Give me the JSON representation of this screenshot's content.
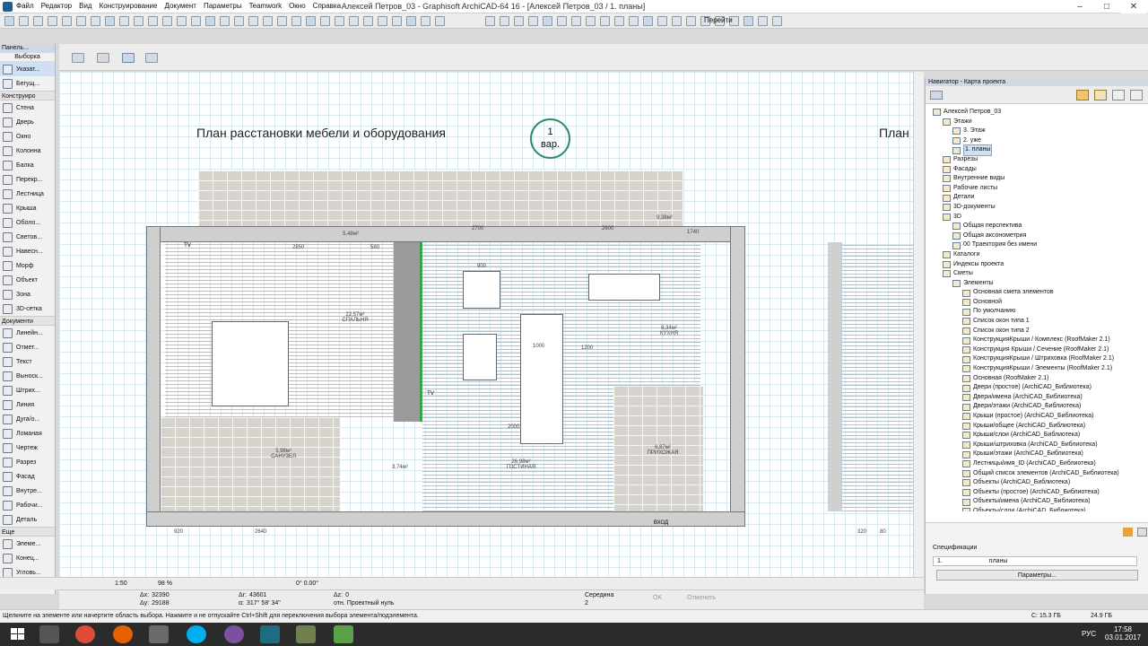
{
  "window": {
    "title": "Алексей Петров_03 - Graphisoft ArchiCAD-64 16 - [Алексей Петров_03 / 1. планы]",
    "menu": [
      "Файл",
      "Редактор",
      "Вид",
      "Конструирование",
      "Документ",
      "Параметры",
      "Teamwork",
      "Окно",
      "Справка"
    ],
    "controls": {
      "minimize": "–",
      "maximize": "□",
      "close": "✕"
    }
  },
  "toolbar": {
    "goto_label": "Перейти"
  },
  "left_panel": {
    "header": "Панель...",
    "selection_title": "Выборка",
    "sections": {
      "construct": "Конструиро",
      "document": "Документи",
      "more": "Еще"
    },
    "top_items": [
      "Указат...",
      "Бегущ..."
    ],
    "construct_items": [
      "Стена",
      "Дверь",
      "Окно",
      "Колонна",
      "Балка",
      "Перекр...",
      "Лестница",
      "Крыша",
      "Оболо...",
      "Светов...",
      "Навесн...",
      "Морф",
      "Объект",
      "Зона",
      "3D-сетка"
    ],
    "document_items": [
      "Линейн...",
      "Отмет...",
      "Текст",
      "Выноск...",
      "Штрих...",
      "Линия",
      "Дуга/о...",
      "Ломаная",
      "Чертеж",
      "Разрез",
      "Фасад",
      "Внутре...",
      "Рабочи...",
      "Деталь"
    ],
    "more_items": [
      "Элеме...",
      "Конец...",
      "Угловь..."
    ]
  },
  "drawing": {
    "title": "План расстановки мебели и оборудования",
    "badge_line1": "1",
    "badge_line2": "вар.",
    "title_clip": "План",
    "rooms": [
      {
        "name": "СПАЛЬНЯ",
        "area": "22,57м²"
      },
      {
        "name": "КУХНЯ",
        "area": "8,34м²"
      },
      {
        "name": "САНУЗЕЛ",
        "area": "5,98м²"
      },
      {
        "name": "ГОСТИНАЯ",
        "area": "26,98м²"
      },
      {
        "name": "ПРИХОЖАЯ",
        "area": "6,87м²"
      },
      {
        "name": "",
        "area": "3,74м²"
      },
      {
        "name": "",
        "area": "5,48м²"
      },
      {
        "name": "",
        "area": "9,38м²"
      }
    ],
    "tv_label": "TV",
    "entry_label": "ВХОД",
    "dims": [
      "2850",
      "580",
      "2700",
      "2600",
      "1200",
      "920",
      "2640",
      "320",
      "80",
      "900",
      "1000",
      "2000",
      "1740"
    ]
  },
  "navigator": {
    "header": "Навигатор - Карта проекта",
    "tree": [
      {
        "level": 0,
        "label": "Алексей Петров_03"
      },
      {
        "level": 1,
        "label": "Этажи"
      },
      {
        "level": 2,
        "label": "3. Этаж"
      },
      {
        "level": 2,
        "label": "2. уже"
      },
      {
        "level": 2,
        "label": "1. планы",
        "selected": true
      },
      {
        "level": 1,
        "label": "Разрезы"
      },
      {
        "level": 1,
        "label": "Фасады"
      },
      {
        "level": 1,
        "label": "Внутренние виды"
      },
      {
        "level": 1,
        "label": "Рабочие листы"
      },
      {
        "level": 1,
        "label": "Детали"
      },
      {
        "level": 1,
        "label": "3D-документы"
      },
      {
        "level": 1,
        "label": "3D"
      },
      {
        "level": 2,
        "label": "Общая перспектива"
      },
      {
        "level": 2,
        "label": "Общая аксонометрия"
      },
      {
        "level": 2,
        "label": "00 Траектория без имени"
      },
      {
        "level": 1,
        "label": "Каталоги"
      },
      {
        "level": 1,
        "label": "Индексы проекта"
      },
      {
        "level": 1,
        "label": "Сметы"
      },
      {
        "level": 2,
        "label": "Элементы"
      },
      {
        "level": 3,
        "label": "Основная смета элементов"
      },
      {
        "level": 3,
        "label": "Основной"
      },
      {
        "level": 3,
        "label": "По умолчанию"
      },
      {
        "level": 3,
        "label": "Список окон типа 1"
      },
      {
        "level": 3,
        "label": "Список окон типа 2"
      },
      {
        "level": 3,
        "label": "КонструкцияКрыши / Комплекс (RoofMaker 2.1)"
      },
      {
        "level": 3,
        "label": "Конструкция Крыши / Сечение (RoofMaker 2.1)"
      },
      {
        "level": 3,
        "label": "КонструкцияКрыши / Штриховка (RoofMaker 2.1)"
      },
      {
        "level": 3,
        "label": "КонструкцияКрыши / Элементы (RoofMaker 2.1)"
      },
      {
        "level": 3,
        "label": "Основная (RoofMaker 2.1)"
      },
      {
        "level": 3,
        "label": "Двери (простое) (ArchiCAD_Библиотека)"
      },
      {
        "level": 3,
        "label": "Двери/имена (ArchiCAD_Библиотека)"
      },
      {
        "level": 3,
        "label": "Двери/этажи (ArchiCAD_Библиотека)"
      },
      {
        "level": 3,
        "label": "Крыши (простое) (ArchiCAD_Библиотека)"
      },
      {
        "level": 3,
        "label": "Крыши/общее (ArchiCAD_Библиотека)"
      },
      {
        "level": 3,
        "label": "Крыши/слои (ArchiCAD_Библиотека)"
      },
      {
        "level": 3,
        "label": "Крыши/штриховка (ArchiCAD_Библиотека)"
      },
      {
        "level": 3,
        "label": "Крыши/этажи (ArchiCAD_Библиотека)"
      },
      {
        "level": 3,
        "label": "Лестницы/имя_ID (ArchiCAD_Библиотека)"
      },
      {
        "level": 3,
        "label": "Общий список элементов (ArchiCAD_Библиотека)"
      },
      {
        "level": 3,
        "label": "Объекты (ArchiCAD_Библиотека)"
      },
      {
        "level": 3,
        "label": "Объекты (простое) (ArchiCAD_Библиотека)"
      },
      {
        "level": 3,
        "label": "Объекты/имена (ArchiCAD_Библиотека)"
      },
      {
        "level": 3,
        "label": "Объекты/слои (ArchiCAD_Библиотека)"
      }
    ],
    "spec_title": "Спецификации",
    "spec_num": "1.",
    "spec_name": "планы",
    "params_button": "Параметры..."
  },
  "infobar": {
    "scale": "1:50",
    "zoom": "98 %",
    "angle": "0° 0.00°"
  },
  "coords": {
    "dx_label": "Δx:",
    "dx": "32390",
    "dy_label": "Δy:",
    "dy": "29188",
    "r_label": "Δr:",
    "r": "43601",
    "a_label": "α:",
    "a": "317° 58' 34\"",
    "z_label": "Δz:",
    "z": "0",
    "z_ref": "отн. Проектный нуль",
    "snap_label": "Середина",
    "snap_value": "2",
    "ok": "OK",
    "cancel": "Отменить"
  },
  "status": {
    "hint": "Щелкните на элементе или начертите область выбора. Нажмите и не отпускайте Ctrl+Shift для переключения выбора элемента/подэлемента.",
    "disk_c": "C: 15.3 ГБ",
    "ram": "24.9 ГБ"
  },
  "taskbar": {
    "time": "17:58",
    "date": "03.01.2017",
    "lang": "РУС"
  }
}
